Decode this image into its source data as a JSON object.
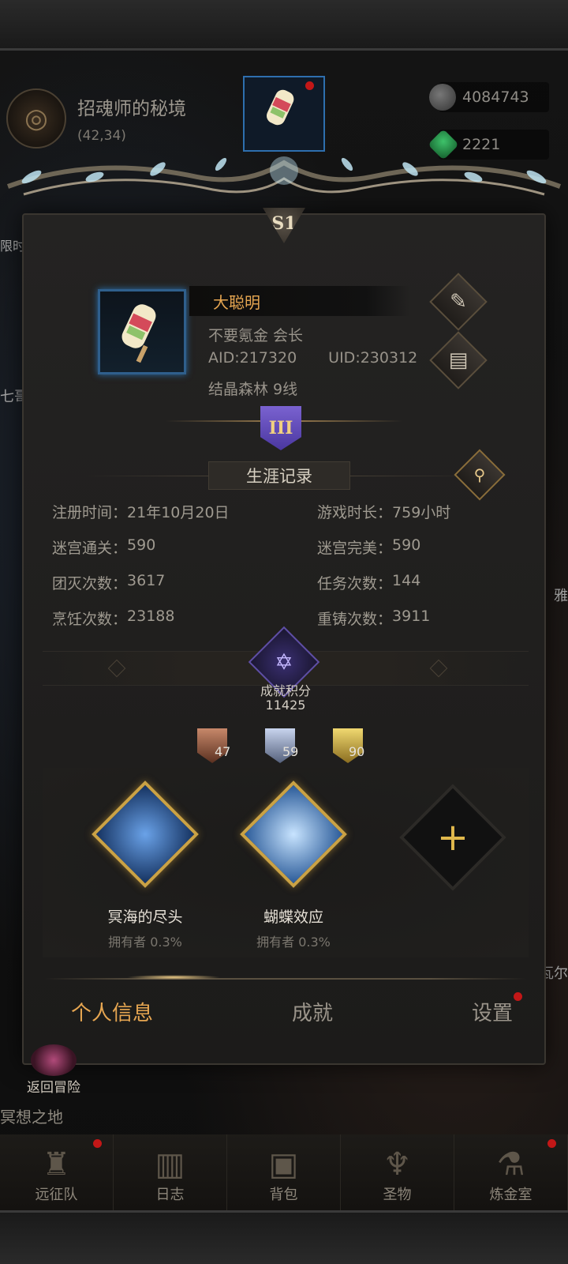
{
  "hud": {
    "location_title": "招魂师的秘境",
    "location_coords": "(42,34)",
    "resource1_value": "4084743",
    "resource2_value": "2221",
    "side_left_1": "限时",
    "side_left_2": "七哥",
    "side_right_1": "雅",
    "side_right_2": "瓦尔",
    "return_label": "返回冒险",
    "zone_label": "冥想之地"
  },
  "panel": {
    "season_badge": "S1",
    "profile": {
      "name": "大聪明",
      "guild_line": "不要氪金 会长",
      "aid": "AID:217320",
      "uid": "UID:230312",
      "server": "结晶森林 9线"
    },
    "rank_badge": "III",
    "career": {
      "title": "生涯记录",
      "stats": [
        {
          "label": "注册时间：",
          "value": "21年10月20日"
        },
        {
          "label": "游戏时长：",
          "value": "759小时"
        },
        {
          "label": "迷宫通关：",
          "value": "590"
        },
        {
          "label": "迷宫完美：",
          "value": "590"
        },
        {
          "label": "团灭次数：",
          "value": "3617"
        },
        {
          "label": "任务次数：",
          "value": "144"
        },
        {
          "label": "烹饪次数：",
          "value": "23188"
        },
        {
          "label": "重铸次数：",
          "value": "3911"
        }
      ]
    },
    "achievement": {
      "points_label": "成就积分",
      "points_value": "11425",
      "bronze_count": "47",
      "silver_count": "59",
      "gold_count": "90",
      "cards": [
        {
          "name": "冥海的尽头",
          "owners": "拥有者 0.3%"
        },
        {
          "name": "蝴蝶效应",
          "owners": "拥有者 0.3%"
        }
      ]
    },
    "tabs": [
      {
        "label": "个人信息"
      },
      {
        "label": "成就"
      },
      {
        "label": "设置"
      }
    ]
  },
  "bottom_nav": [
    {
      "label": "远征队",
      "icon": "viking-helmet-icon"
    },
    {
      "label": "日志",
      "icon": "scroll-icon"
    },
    {
      "label": "背包",
      "icon": "backpack-icon"
    },
    {
      "label": "圣物",
      "icon": "relic-icon"
    },
    {
      "label": "炼金室",
      "icon": "alchemy-icon"
    }
  ],
  "colors": {
    "accent_gold": "#e6a651",
    "notify_red": "#c21717",
    "panel_bg": "#242322"
  }
}
